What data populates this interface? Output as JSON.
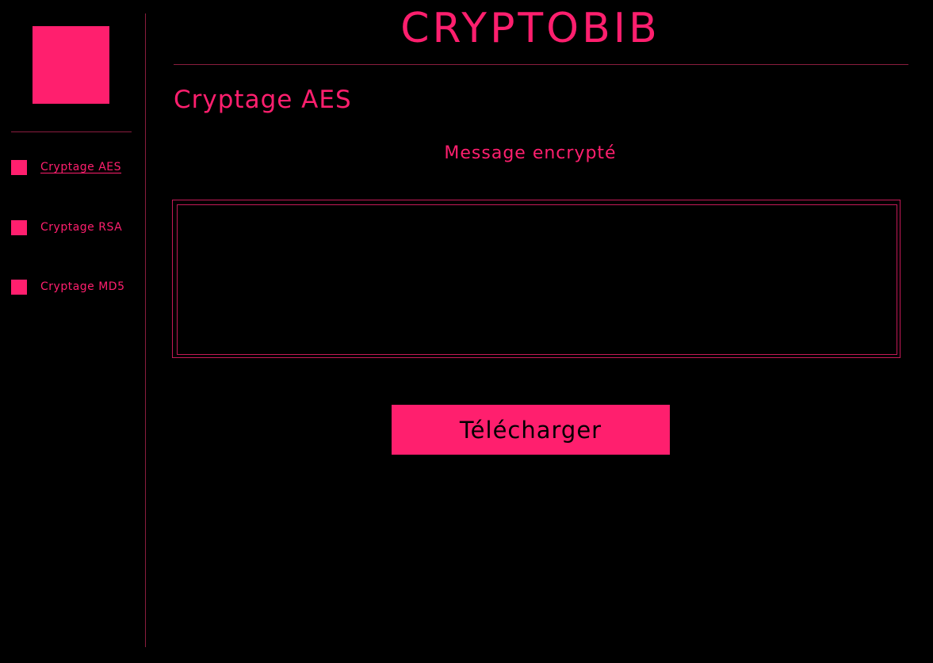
{
  "app": {
    "title": "CRYPTOBIB"
  },
  "sidebar": {
    "items": [
      {
        "label": "Cryptage AES",
        "active": true
      },
      {
        "label": "Cryptage RSA",
        "active": false
      },
      {
        "label": "Cryptage MD5",
        "active": false
      }
    ]
  },
  "main": {
    "page_title": "Cryptage AES",
    "output_label": "Message encrypté",
    "output_value": "",
    "download_label": "Télécharger"
  },
  "colors": {
    "accent": "#ff1f6e",
    "background": "#000000",
    "divider": "#8a1d3e"
  }
}
